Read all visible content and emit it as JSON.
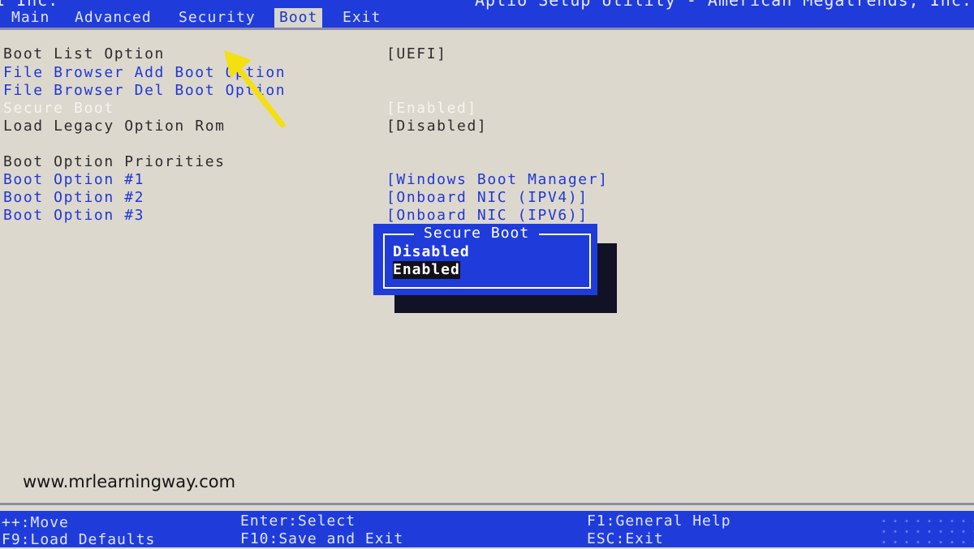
{
  "header": {
    "vendor_fragment": "I Inc.",
    "utility_title": "Aptio Setup Utility - American Megatrends, Inc.",
    "tabs": [
      {
        "label": "Main"
      },
      {
        "label": "Advanced"
      },
      {
        "label": "Security"
      },
      {
        "label": "Boot"
      },
      {
        "label": "Exit"
      }
    ],
    "active_tab": "Boot"
  },
  "boot_settings": {
    "rows": [
      {
        "label": "Boot List Option",
        "value": "[UEFI]"
      },
      {
        "label": "File Browser Add Boot Option",
        "value": ""
      },
      {
        "label": "File Browser Del Boot Option",
        "value": ""
      },
      {
        "label": "Secure Boot",
        "value": "[Enabled]"
      },
      {
        "label": "Load Legacy Option Rom",
        "value": "[Disabled]"
      },
      {
        "label": "Boot Option Priorities",
        "value": ""
      },
      {
        "label": "Boot Option #1",
        "value": "[Windows Boot Manager]"
      },
      {
        "label": "Boot Option #2",
        "value": "[Onboard NIC (IPV4)]"
      },
      {
        "label": "Boot Option #3",
        "value": "[Onboard NIC (IPV6)]"
      }
    ],
    "highlighted_row": "Secure Boot"
  },
  "popup": {
    "title": "Secure Boot",
    "options": [
      "Disabled",
      "Enabled"
    ],
    "selected": "Enabled"
  },
  "watermark": "www.mrlearningway.com",
  "help_bar": {
    "move": "++:Move",
    "load_defaults": "F9:Load Defaults",
    "select": "Enter:Select",
    "save_exit": "F10:Save and Exit",
    "general_help": "F1:General Help",
    "exit": "ESC:Exit"
  },
  "colors": {
    "bios_blue": "#1f3cdb",
    "background": "#dcd8ce",
    "annotation_arrow": "#f4df10"
  },
  "icons": {
    "annotation": "arrow-pointer-icon"
  }
}
